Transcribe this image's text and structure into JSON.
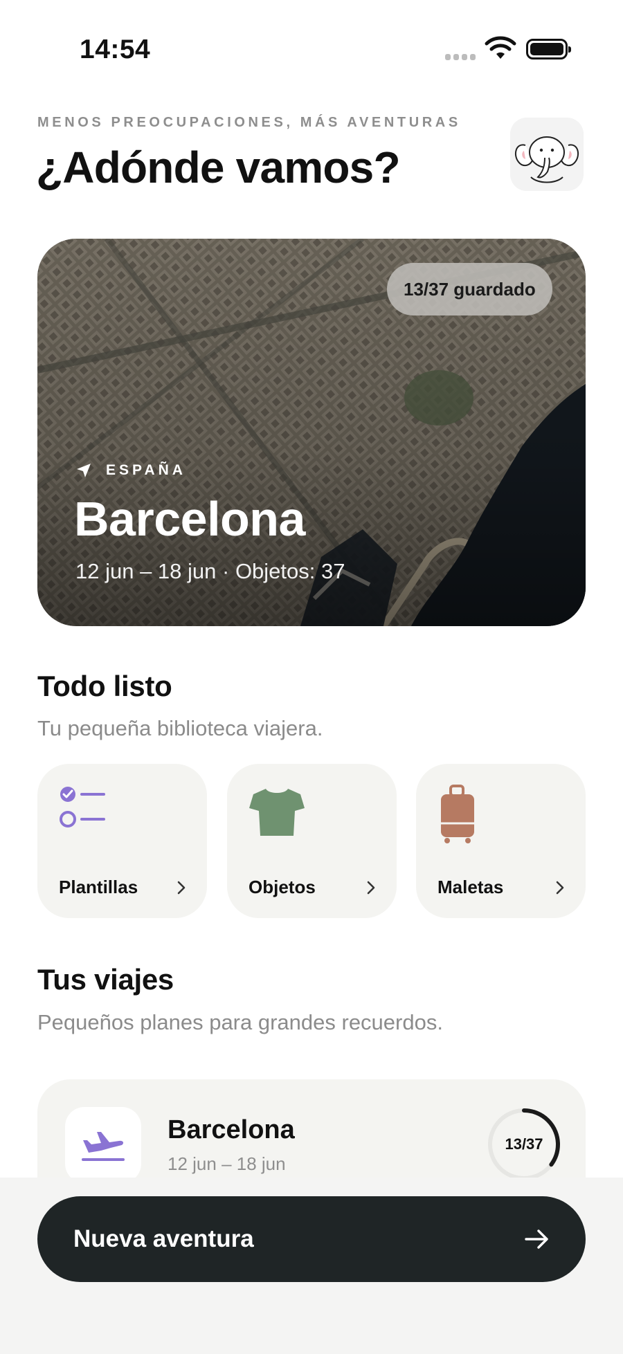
{
  "status_bar": {
    "time": "14:54"
  },
  "header": {
    "kicker": "MENOS PREOCUPACIONES, MÁS AVENTURAS",
    "title": "¿Adónde vamos?"
  },
  "hero": {
    "badge": "13/37 guardado",
    "country": "ESPAÑA",
    "city": "Barcelona",
    "meta": "12 jun – 18 jun · Objetos: 37"
  },
  "library": {
    "title": "Todo listo",
    "subtitle": "Tu pequeña biblioteca viajera.",
    "tiles": [
      {
        "label": "Plantillas",
        "icon": "checklist-icon",
        "color": "#8a73d3"
      },
      {
        "label": "Objetos",
        "icon": "tshirt-icon",
        "color": "#6f9270"
      },
      {
        "label": "Maletas",
        "icon": "suitcase-icon",
        "color": "#b67a62"
      }
    ]
  },
  "trips": {
    "title": "Tus viajes",
    "subtitle": "Pequeños planes para grandes recuerdos.",
    "items": [
      {
        "title": "Barcelona",
        "dates": "12 jun – 18 jun",
        "progress_label": "13/37",
        "progress": 0.351,
        "icon": "plane-icon"
      }
    ]
  },
  "cta": {
    "label": "Nueva aventura"
  },
  "colors": {
    "accent_purple": "#8a73d3",
    "cta_background": "#1f2526",
    "tile_background": "#f4f4f1"
  }
}
